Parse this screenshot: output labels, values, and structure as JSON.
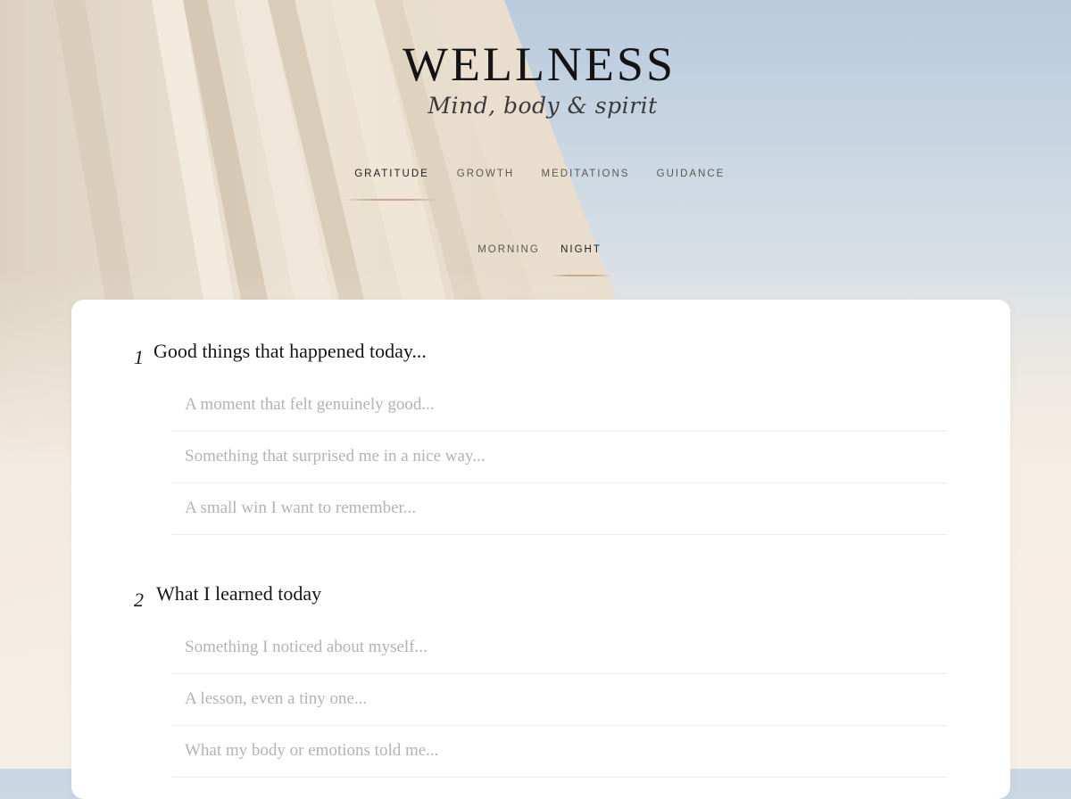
{
  "brand": {
    "title": "WELLNESS",
    "tagline": "Mind, body & spirit"
  },
  "nav": {
    "tabs": [
      {
        "label": "GRATITUDE",
        "active": true
      },
      {
        "label": "GROWTH",
        "active": false
      },
      {
        "label": "MEDITATIONS",
        "active": false
      },
      {
        "label": "GUIDANCE",
        "active": false
      }
    ]
  },
  "subnav": {
    "tabs": [
      {
        "label": "MORNING",
        "active": false
      },
      {
        "label": "NIGHT",
        "active": true
      }
    ]
  },
  "sections": [
    {
      "number": "1",
      "title": "Good things that happened today...",
      "prompts": [
        {
          "placeholder": "A moment that felt genuinely good...",
          "value": ""
        },
        {
          "placeholder": "Something that surprised me in a nice way...",
          "value": ""
        },
        {
          "placeholder": "A small win I want to remember...",
          "value": ""
        }
      ]
    },
    {
      "number": "2",
      "title": "What I learned today",
      "prompts": [
        {
          "placeholder": "Something I noticed about myself...",
          "value": ""
        },
        {
          "placeholder": "A lesson, even a tiny one...",
          "value": ""
        },
        {
          "placeholder": "What my body or emotions told me...",
          "value": ""
        }
      ]
    }
  ],
  "colors": {
    "accent_underline": "#c7a985",
    "sky": "#b9cadd",
    "linen": "#e9dccb",
    "card": "#ffffff"
  }
}
